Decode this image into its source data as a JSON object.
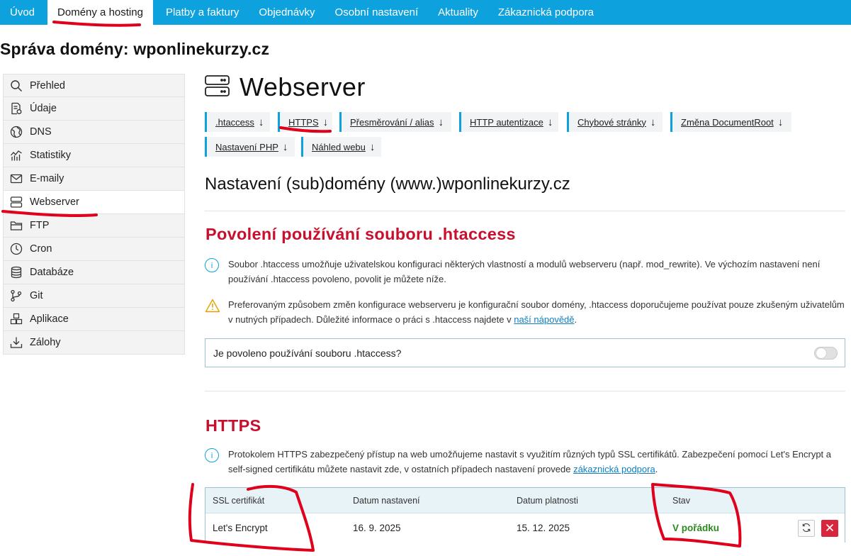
{
  "nav": {
    "items": [
      {
        "label": "Úvod"
      },
      {
        "label": "Domény a hosting"
      },
      {
        "label": "Platby a faktury"
      },
      {
        "label": "Objednávky"
      },
      {
        "label": "Osobní nastavení"
      },
      {
        "label": "Aktuality"
      },
      {
        "label": "Zákaznická podpora"
      }
    ],
    "active_index": 1
  },
  "page_title": "Správa domény: wponlinekurzy.cz",
  "sidebar": {
    "items": [
      {
        "label": "Přehled",
        "icon": "search-icon"
      },
      {
        "label": "Údaje",
        "icon": "document-icon"
      },
      {
        "label": "DNS",
        "icon": "globe-icon"
      },
      {
        "label": "Statistiky",
        "icon": "chart-icon"
      },
      {
        "label": "E-maily",
        "icon": "mail-icon"
      },
      {
        "label": "Webserver",
        "icon": "server-icon"
      },
      {
        "label": "FTP",
        "icon": "folder-icon"
      },
      {
        "label": "Cron",
        "icon": "clock-icon"
      },
      {
        "label": "Databáze",
        "icon": "database-icon"
      },
      {
        "label": "Git",
        "icon": "git-icon"
      },
      {
        "label": "Aplikace",
        "icon": "apps-icon"
      },
      {
        "label": "Zálohy",
        "icon": "download-icon"
      }
    ],
    "active_index": 5
  },
  "main": {
    "title": "Webserver",
    "tabs": [
      {
        "label": ".htaccess"
      },
      {
        "label": "HTTPS"
      },
      {
        "label": "Přesměrování / alias"
      },
      {
        "label": "HTTP autentizace"
      },
      {
        "label": "Chybové stránky"
      },
      {
        "label": "Změna DocumentRoot"
      },
      {
        "label": "Nastavení PHP"
      },
      {
        "label": "Náhled webu"
      }
    ],
    "tab_arrow": "↓",
    "subdomain_title": "Nastavení (sub)domény (www.)wponlinekurzy.cz"
  },
  "htaccess": {
    "title": "Povolení používání souboru .htaccess",
    "info_text": "Soubor .htaccess umožňuje uživatelskou konfiguraci některých vlastností a modulů webserveru (např. mod_rewrite). Ve výchozím nastavení není používání .htaccess povoleno, povolit je můžete níže.",
    "warning_text": "Preferovaným způsobem změn konfigurace webserveru je konfigurační soubor domény, .htaccess doporučujeme používat pouze zkušeným uživatelům v nutných případech. Důležité informace o práci s .htaccess najdete v ",
    "warning_link": "naší nápovědě",
    "warning_end": ".",
    "toggle_label": "Je povoleno používání souboru .htaccess?",
    "toggle_on": false
  },
  "https": {
    "title": "HTTPS",
    "info_text": "Protokolem HTTPS zabezpečený přístup na web umožňujeme nastavit s využitím různých typů SSL certifikátů. Zabezpečení pomocí Let's Encrypt a self-signed certifikátu můžete nastavit zde, v ostatních případech nastavení provede ",
    "info_link": "zákaznická podpora",
    "info_end": ".",
    "table": {
      "headers": [
        "SSL certifikát",
        "Datum nastavení",
        "Datum platnosti",
        "Stav"
      ],
      "rows": [
        {
          "cert": "Let's Encrypt",
          "set_date": "16. 9. 2025",
          "valid_date": "15. 12. 2025",
          "status": "V pořádku"
        }
      ]
    }
  },
  "colors": {
    "accent": "#0da1dd",
    "section_red": "#c8102e",
    "status_green": "#2a8a1d",
    "annotation_red": "#e0001b"
  }
}
